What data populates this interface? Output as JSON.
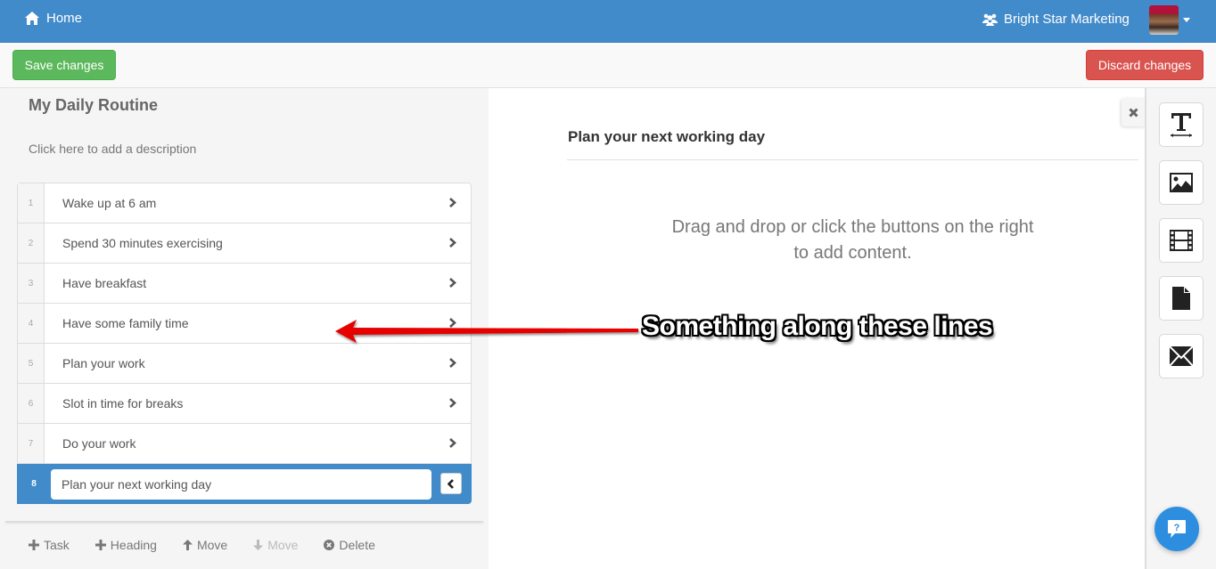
{
  "navbar": {
    "home_label": "Home",
    "org_name": "Bright Star Marketing",
    "brand_color": "#428bca"
  },
  "toolbar": {
    "save_label": "Save changes",
    "discard_label": "Discard changes"
  },
  "routine": {
    "title": "My Daily Routine",
    "description_placeholder": "Click here to add a description",
    "tasks": [
      {
        "number": "1",
        "label": "Wake up at 6 am"
      },
      {
        "number": "2",
        "label": "Spend 30 minutes exercising"
      },
      {
        "number": "3",
        "label": "Have breakfast"
      },
      {
        "number": "4",
        "label": "Have some family time"
      },
      {
        "number": "5",
        "label": "Plan your work"
      },
      {
        "number": "6",
        "label": "Slot in time for breaks"
      },
      {
        "number": "7",
        "label": "Do your work"
      }
    ],
    "active_task": {
      "number": "8",
      "label": "Plan your next working day"
    }
  },
  "footer_actions": {
    "add_task": "Task",
    "add_heading": "Heading",
    "move_up": "Move",
    "move_down": "Move",
    "delete": "Delete"
  },
  "content": {
    "title": "Plan your next working day",
    "hint_line1": "Drag and drop or click the buttons on the right",
    "hint_line2": "to add content."
  },
  "tools": [
    "text-tool",
    "image-tool",
    "video-tool",
    "document-tool",
    "email-tool"
  ],
  "annotation": {
    "text": "Something along these lines",
    "arrow_color": "#e00000"
  }
}
